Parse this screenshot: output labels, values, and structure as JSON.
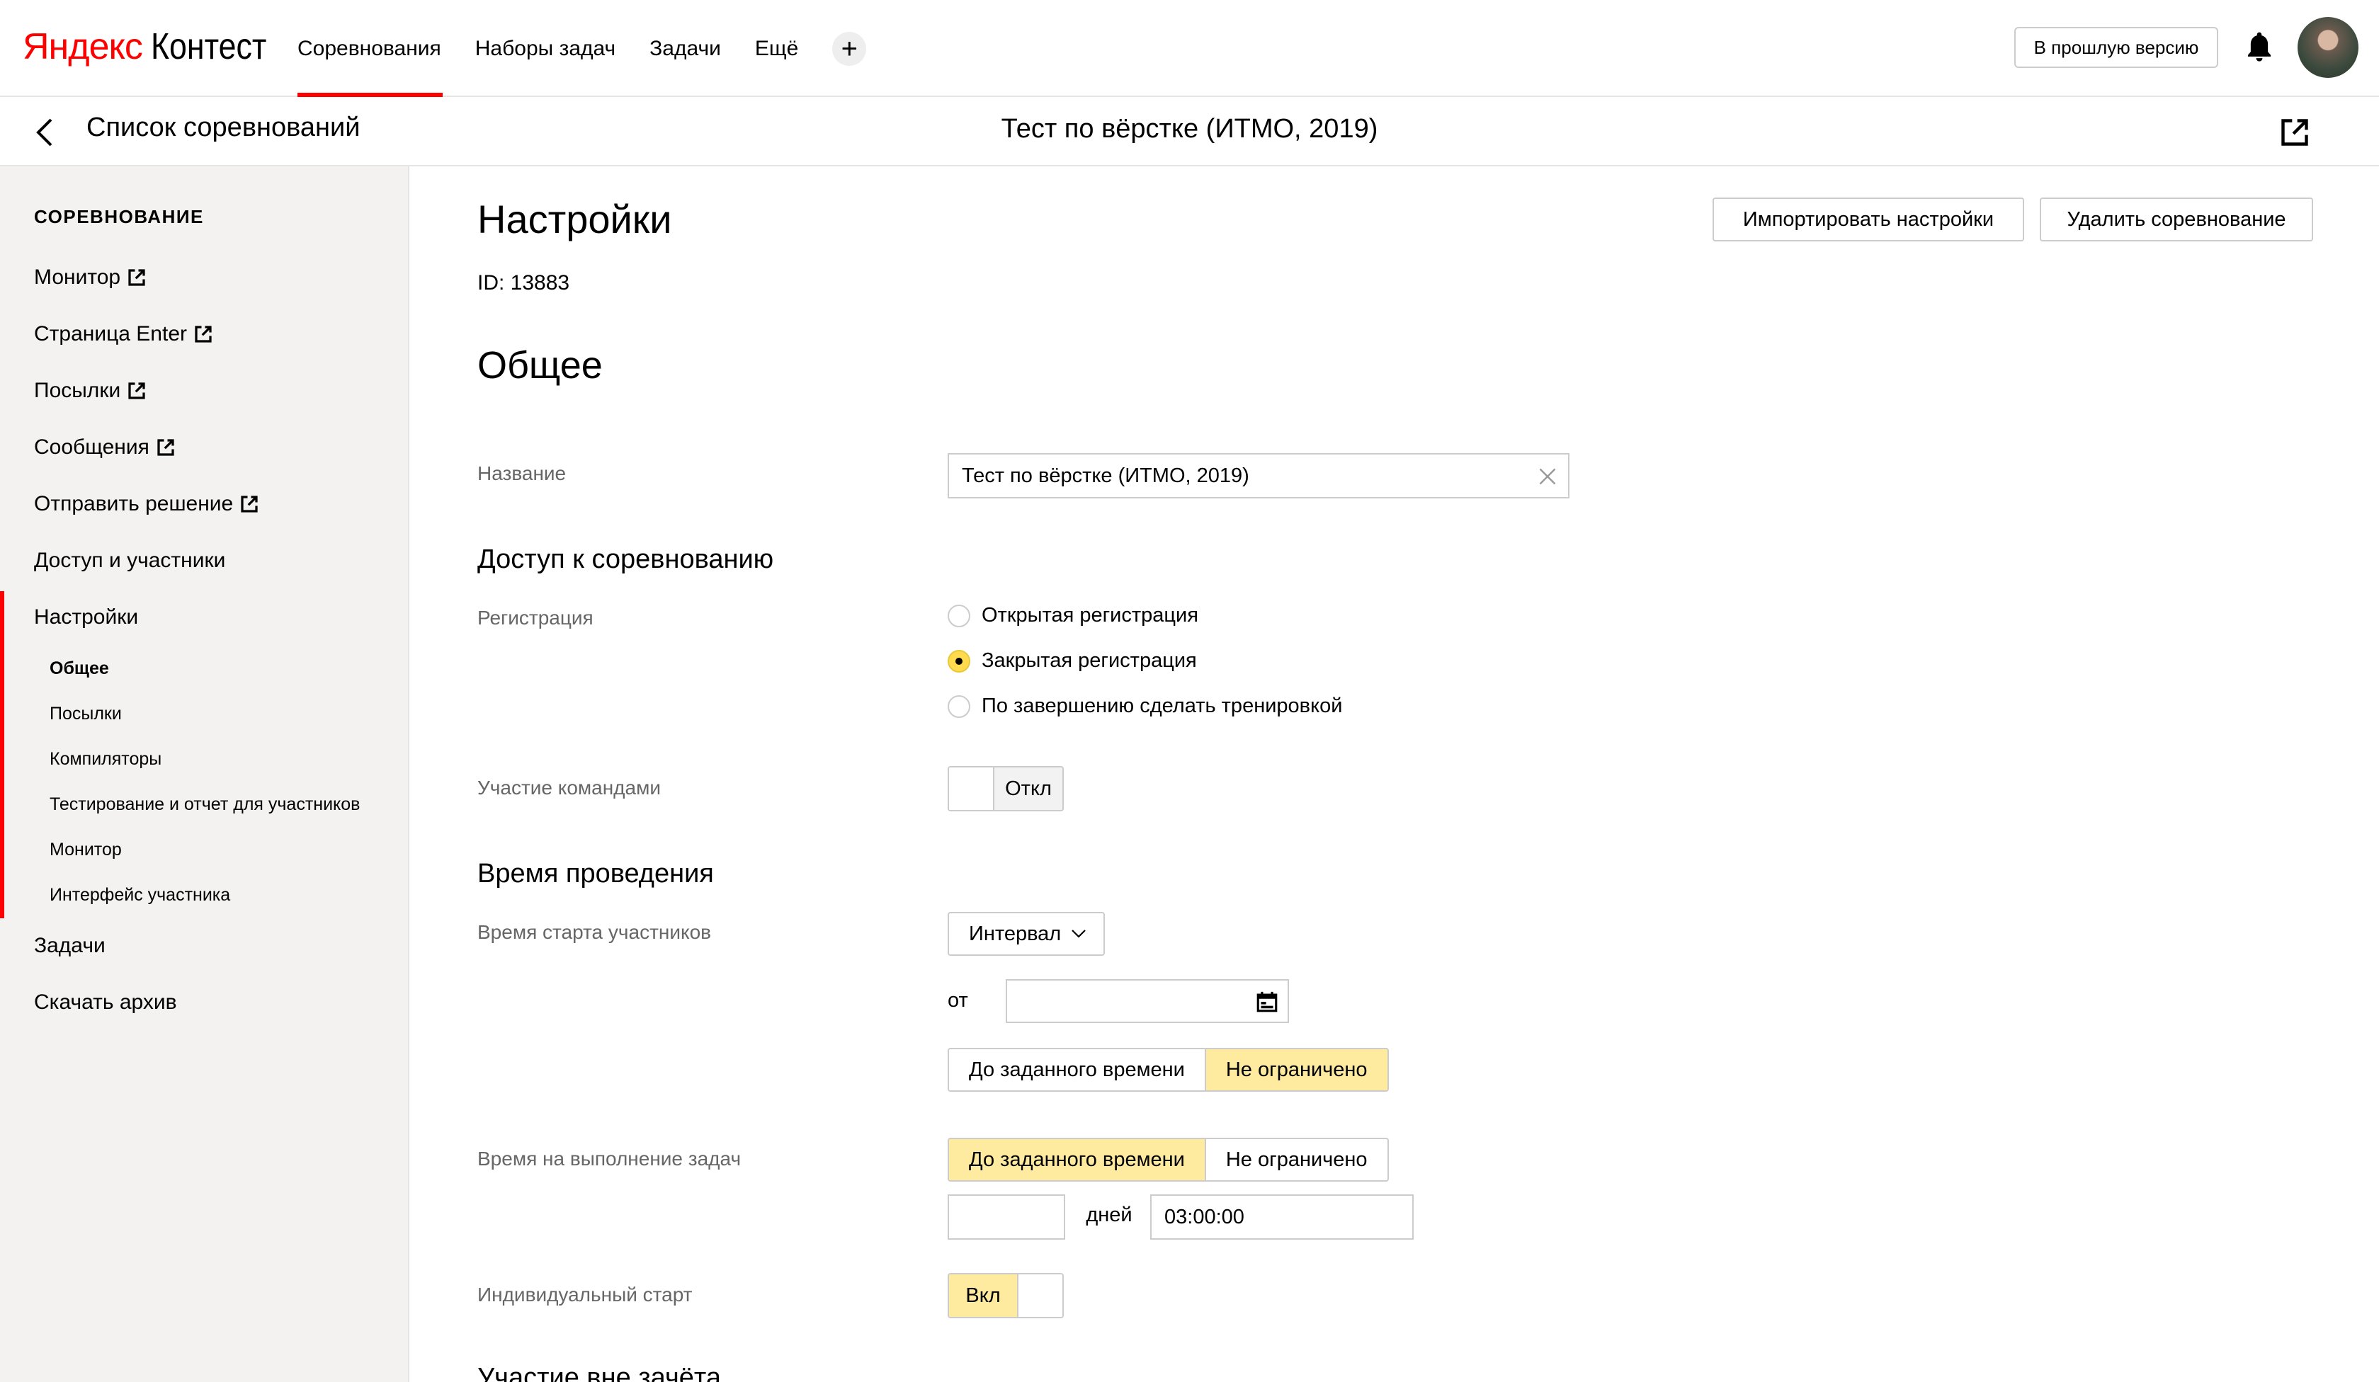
{
  "header": {
    "logo_brand": "Яндекс",
    "logo_product": "Контест",
    "nav": [
      "Соревнования",
      "Наборы задач",
      "Задачи",
      "Ещё"
    ],
    "plus": "+",
    "old_version": "В прошлую версию",
    "icons": {
      "bell": "bell-icon",
      "plus": "plus-icon",
      "avatar": "avatar"
    }
  },
  "subheader": {
    "back_label": "Список соревнований",
    "contest_title": "Тест по вёрстке (ИТМО, 2019)"
  },
  "sidebar": {
    "heading": "СОРЕВНОВАНИЕ",
    "items": [
      {
        "label": "Монитор",
        "external": true
      },
      {
        "label": "Страница Enter",
        "external": true
      },
      {
        "label": "Посылки",
        "external": true
      },
      {
        "label": "Сообщения",
        "external": true
      },
      {
        "label": "Отправить решение",
        "external": true
      },
      {
        "label": "Доступ и участники",
        "external": false
      },
      {
        "label": "Настройки",
        "external": false
      }
    ],
    "sub_items": [
      "Общее",
      "Посылки",
      "Компиляторы",
      "Тестирование и отчет для участников",
      "Монитор",
      "Интерфейс участника"
    ],
    "bottom_items": [
      "Задачи",
      "Скачать архив"
    ]
  },
  "main": {
    "title": "Настройки",
    "id_text": "ID: 13883",
    "import_btn": "Импортировать настройки",
    "delete_btn": "Удалить соревнование",
    "section_general": "Общее",
    "name_label": "Название",
    "name_value": "Тест по вёрстке (ИТМО, 2019)",
    "access_heading": "Доступ к соревнованию",
    "registration_label": "Регистрация",
    "registration_options": [
      "Открытая регистрация",
      "Закрытая регистрация",
      "По завершению сделать тренировкой"
    ],
    "registration_selected": 1,
    "teams_label": "Участие командами",
    "teams_toggle": "Откл",
    "time_heading": "Время проведения",
    "start_time_label": "Время старта участников",
    "start_time_select": "Интервал",
    "from_label": "от",
    "from_value": "",
    "start_seg": [
      "До заданного времени",
      "Не ограничено"
    ],
    "start_seg_active": 1,
    "duration_label": "Время на выполнение задач",
    "duration_seg": [
      "До заданного времени",
      "Не ограничено"
    ],
    "duration_seg_active": 0,
    "days_value": "",
    "days_label": "дней",
    "time_value": "03:00:00",
    "individual_label": "Индивидуальный старт",
    "individual_toggle": "Вкл",
    "next_heading": "Участие вне зачёта"
  },
  "colors": {
    "accent_red": "#ff0000",
    "active_yellow": "#ffeba0",
    "sidebar_bg": "#f3f2f1"
  }
}
